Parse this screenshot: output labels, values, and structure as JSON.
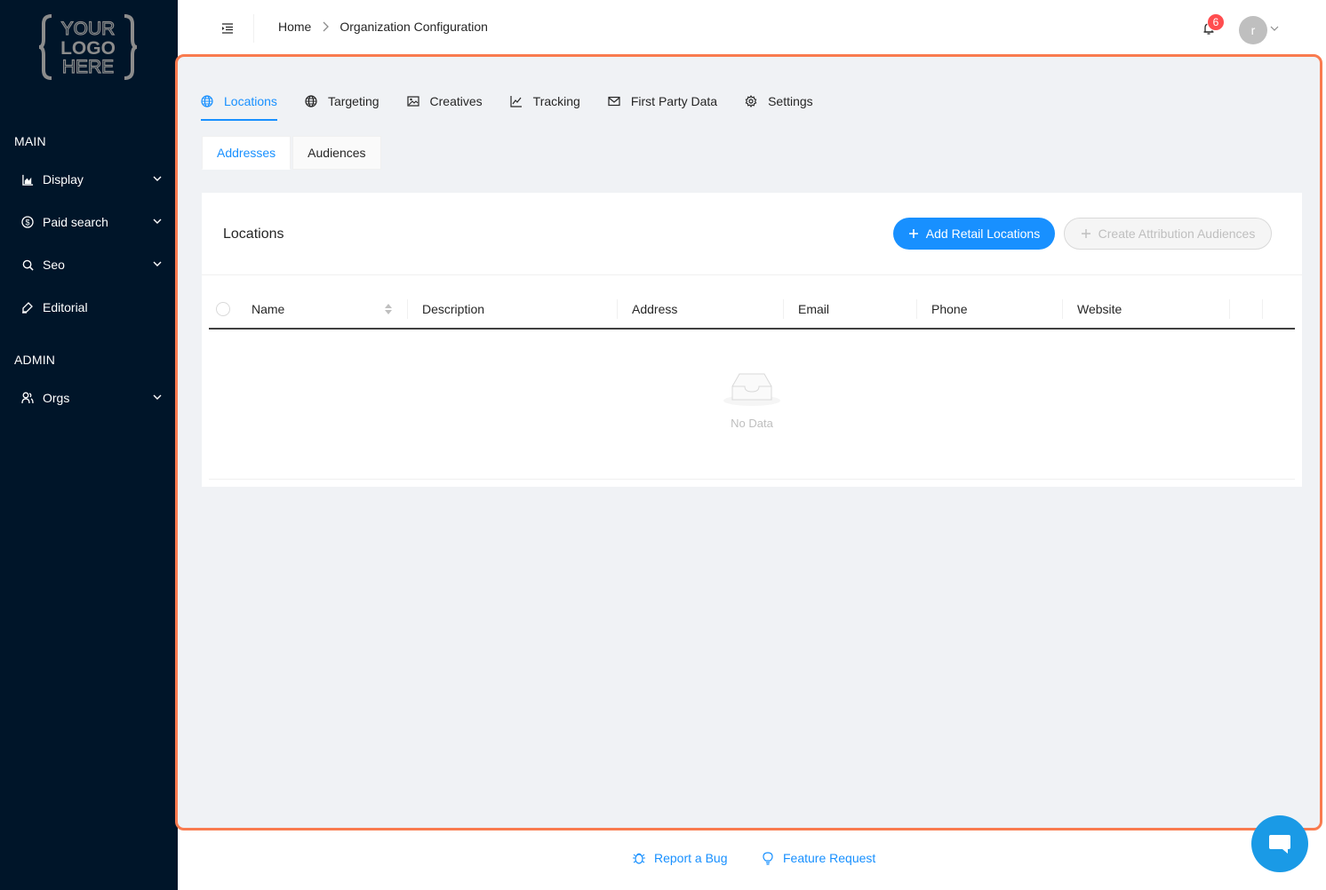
{
  "logo": {
    "line1": "YOUR",
    "line2": "LOGO",
    "line3": "HERE"
  },
  "sidebar": {
    "main_label": "MAIN",
    "admin_label": "ADMIN",
    "items": [
      {
        "label": "Display",
        "icon": "area-chart-icon"
      },
      {
        "label": "Paid search",
        "icon": "dollar-icon"
      },
      {
        "label": "Seo",
        "icon": "search-icon"
      },
      {
        "label": "Editorial",
        "icon": "highlight-pen-icon"
      },
      {
        "label": "Orgs",
        "icon": "user-group-icon"
      }
    ]
  },
  "header": {
    "breadcrumb_home": "Home",
    "breadcrumb_current": "Organization Configuration",
    "notification_count": "6",
    "avatar_initial": "r"
  },
  "tabs": [
    {
      "label": "Locations",
      "icon": "globe-icon",
      "active": true
    },
    {
      "label": "Targeting",
      "icon": "globe-icon"
    },
    {
      "label": "Creatives",
      "icon": "picture-icon"
    },
    {
      "label": "Tracking",
      "icon": "line-chart-icon"
    },
    {
      "label": "First Party Data",
      "icon": "mail-icon"
    },
    {
      "label": "Settings",
      "icon": "gear-icon"
    }
  ],
  "subtabs": [
    {
      "label": "Addresses",
      "active": true
    },
    {
      "label": "Audiences"
    }
  ],
  "card": {
    "title": "Locations",
    "add_button": "Add Retail Locations",
    "create_button": "Create Attribution Audiences"
  },
  "table": {
    "columns": [
      "Name",
      "Description",
      "Address",
      "Email",
      "Phone",
      "Website"
    ],
    "empty_text": "No Data"
  },
  "footer": {
    "report_bug": "Report a Bug",
    "feature_request": "Feature Request"
  },
  "colors": {
    "sidebar_bg": "#001529",
    "primary": "#1890ff",
    "highlight_border": "#f97b4f",
    "badge": "#ff4d4f"
  }
}
